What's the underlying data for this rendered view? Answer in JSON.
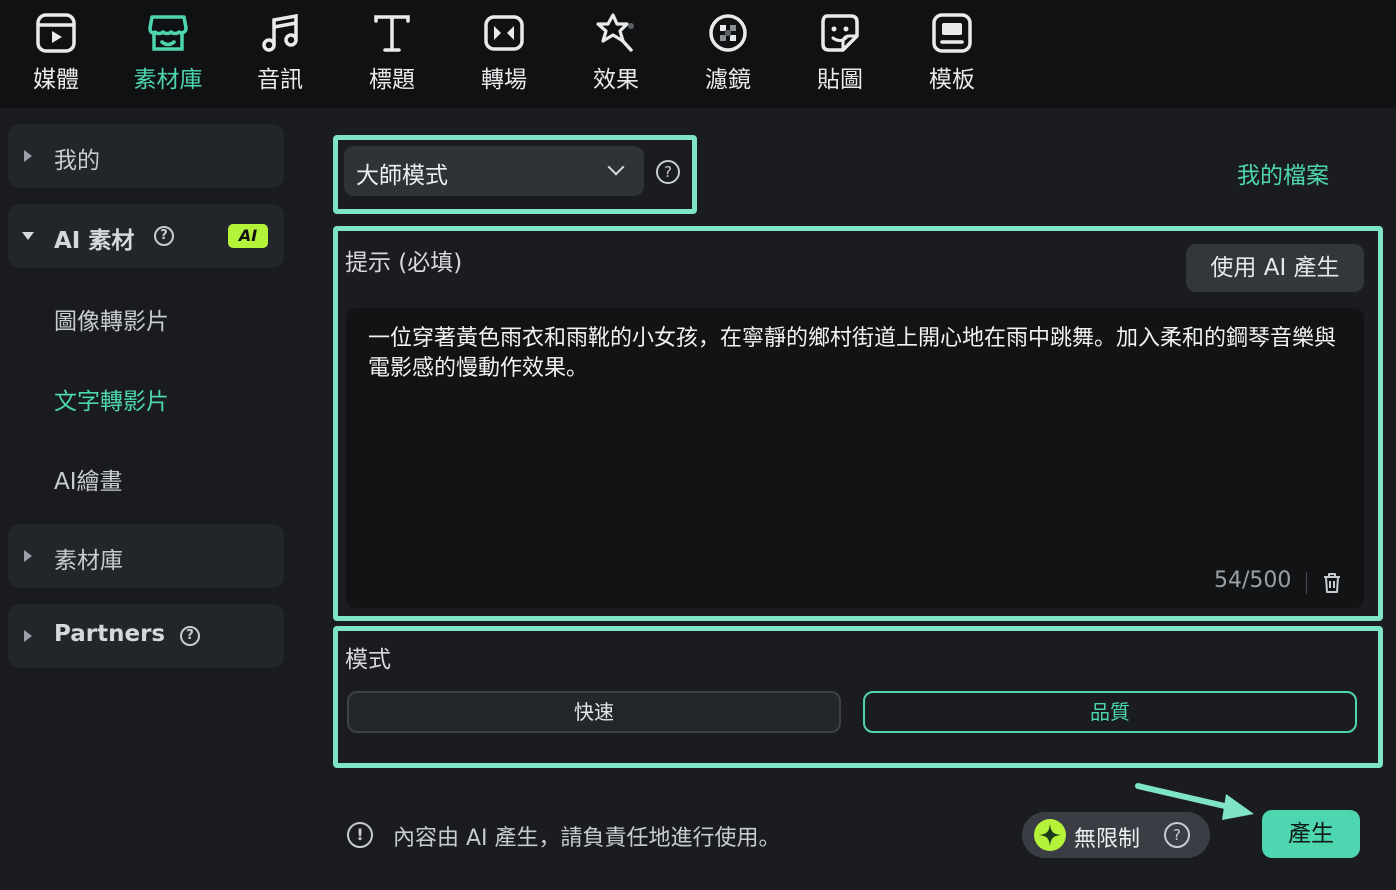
{
  "top_tabs": [
    {
      "label": "媒體",
      "icon": "media-icon"
    },
    {
      "label": "素材庫",
      "icon": "store-icon",
      "active": true
    },
    {
      "label": "音訊",
      "icon": "music-note-icon"
    },
    {
      "label": "標題",
      "icon": "title-text-icon"
    },
    {
      "label": "轉場",
      "icon": "transition-icon"
    },
    {
      "label": "效果",
      "icon": "effects-star-icon"
    },
    {
      "label": "濾鏡",
      "icon": "filter-icon"
    },
    {
      "label": "貼圖",
      "icon": "sticker-icon"
    },
    {
      "label": "模板",
      "icon": "template-icon"
    }
  ],
  "sidebar": {
    "my": "我的",
    "ai_group": {
      "label": "AI 素材",
      "badge": "AI"
    },
    "ai_items": [
      "圖像轉影片",
      "文字轉影片",
      "AI繪畫"
    ],
    "active_item": "文字轉影片",
    "library": "素材庫",
    "partners": "Partners"
  },
  "main": {
    "mode_select": {
      "value": "大師模式"
    },
    "my_files_link": "我的檔案",
    "prompt": {
      "label": "提示 (必填)",
      "ai_button": "使用 AI 產生",
      "text": "一位穿著黃色雨衣和雨靴的小女孩，在寧靜的鄉村街道上開心地在雨中跳舞。加入柔和的鋼琴音樂與電影感的慢動作效果。",
      "counter": "54/500"
    },
    "mode": {
      "label": "模式",
      "options": [
        "快速",
        "品質"
      ],
      "selected": "品質"
    },
    "notice": "內容由 AI 產生，請負責任地進行使用。",
    "unlimited": "無限制",
    "generate_button": "產生"
  },
  "colors": {
    "accent": "#4ed6b0",
    "highlight": "#7fe3c6",
    "ai_badge": "#b5f23a",
    "background": "#1a1c1f"
  }
}
